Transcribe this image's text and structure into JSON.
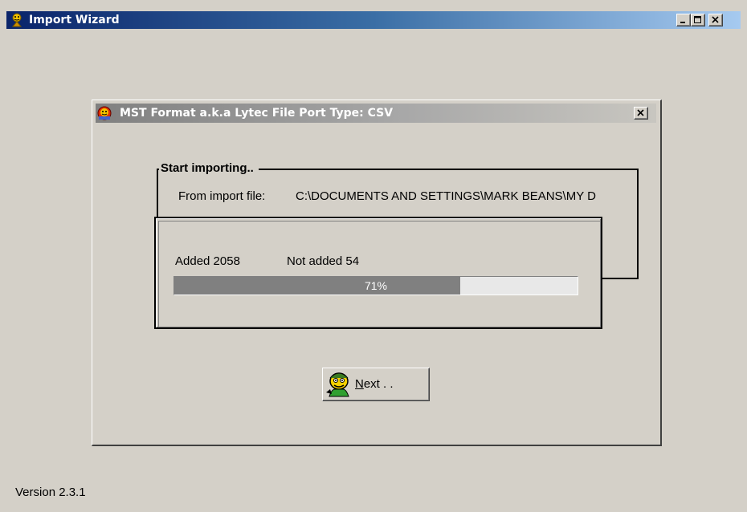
{
  "window": {
    "title": "Import Wizard",
    "icon": "wizard-app-icon",
    "controls": [
      "minimize-icon",
      "maximize-icon",
      "close-icon"
    ]
  },
  "dialog": {
    "title": "MST Format a.k.a Lytec File Port Type: CSV",
    "icon": "wizard-dialog-icon",
    "close_icon": "close-icon"
  },
  "import": {
    "group_label": "Start importing..",
    "from_label": "From import file:",
    "from_path": "C:\\DOCUMENTS AND SETTINGS\\MARK BEANS\\MY D"
  },
  "progress": {
    "added_label": "Added 2058",
    "not_added_label": "Not added 54",
    "percent_text": "71%",
    "percent": 71
  },
  "next_button": {
    "mnemonic": "N",
    "rest": "ext . .",
    "icon": "wizard-face-icon"
  },
  "footer": {
    "version": "Version 2.3.1"
  },
  "colors": {
    "face": "#d4d0c8",
    "titlebar_active": "#0a246a",
    "titlebar_inactive": "#808080",
    "progress_fill": "#808080"
  }
}
